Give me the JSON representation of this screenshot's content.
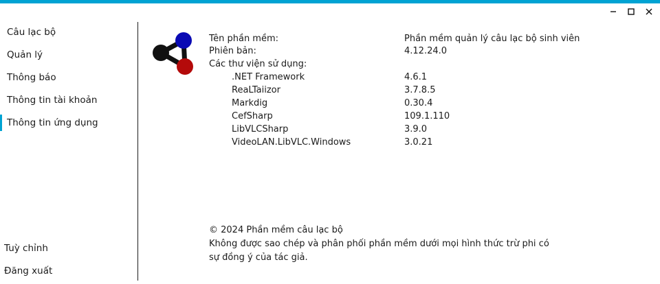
{
  "window": {
    "accent_color": "#00a3d3",
    "controls": {
      "minimize_icon": "minimize-icon",
      "maximize_icon": "maximize-icon",
      "close_icon": "close-icon"
    }
  },
  "sidebar": {
    "items": [
      {
        "label": "Câu lạc bộ"
      },
      {
        "label": "Quản lý"
      },
      {
        "label": "Thông báo"
      },
      {
        "label": "Thông tin tài khoản"
      },
      {
        "label": "Thông tin ứng dụng",
        "active": true
      }
    ],
    "bottom_items": [
      {
        "label": "Tuỳ chỉnh"
      },
      {
        "label": "Đăng xuất"
      }
    ]
  },
  "app_info": {
    "logo_icon": "molecule-logo-icon",
    "logo_colors": [
      "#111111",
      "#0a0ab4",
      "#b40a0a"
    ],
    "software_name_label": "Tên phần mềm:",
    "software_name_value": "Phần mềm quản lý câu lạc bộ sinh viên",
    "version_label": "Phiên bản:",
    "version_value": "4.12.24.0",
    "libraries_label": "Các thư viện sử dụng:",
    "libraries": [
      {
        "name": ".NET Framework",
        "version": "4.6.1"
      },
      {
        "name": "ReaLTaiizor",
        "version": "3.7.8.5"
      },
      {
        "name": "Markdig",
        "version": "0.30.4"
      },
      {
        "name": "CefSharp",
        "version": "109.1.110"
      },
      {
        "name": "LibVLCSharp",
        "version": "3.9.0"
      },
      {
        "name": "VideoLAN.LibVLC.Windows",
        "version": "3.0.21"
      }
    ]
  },
  "footer": {
    "copyright": "© 2024 Phần mềm câu lạc bộ",
    "notice": "Không được sao chép và phân phối phần mềm dưới mọi hình thức trừ phi có sự đồng ý của tác giả."
  }
}
